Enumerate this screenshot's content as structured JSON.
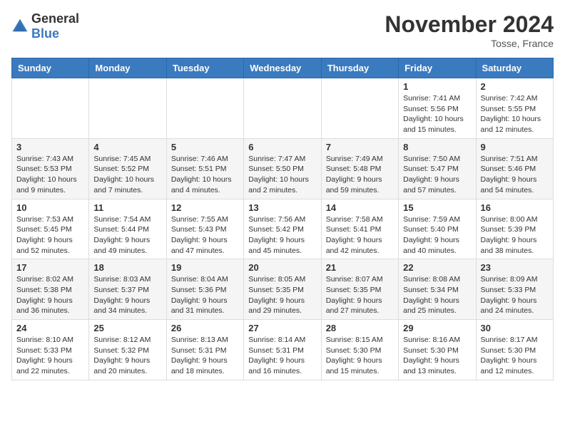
{
  "header": {
    "logo_general": "General",
    "logo_blue": "Blue",
    "title": "November 2024",
    "location": "Tosse, France"
  },
  "weekdays": [
    "Sunday",
    "Monday",
    "Tuesday",
    "Wednesday",
    "Thursday",
    "Friday",
    "Saturday"
  ],
  "weeks": [
    [
      {
        "day": "",
        "info": ""
      },
      {
        "day": "",
        "info": ""
      },
      {
        "day": "",
        "info": ""
      },
      {
        "day": "",
        "info": ""
      },
      {
        "day": "",
        "info": ""
      },
      {
        "day": "1",
        "info": "Sunrise: 7:41 AM\nSunset: 5:56 PM\nDaylight: 10 hours\nand 15 minutes."
      },
      {
        "day": "2",
        "info": "Sunrise: 7:42 AM\nSunset: 5:55 PM\nDaylight: 10 hours\nand 12 minutes."
      }
    ],
    [
      {
        "day": "3",
        "info": "Sunrise: 7:43 AM\nSunset: 5:53 PM\nDaylight: 10 hours\nand 9 minutes."
      },
      {
        "day": "4",
        "info": "Sunrise: 7:45 AM\nSunset: 5:52 PM\nDaylight: 10 hours\nand 7 minutes."
      },
      {
        "day": "5",
        "info": "Sunrise: 7:46 AM\nSunset: 5:51 PM\nDaylight: 10 hours\nand 4 minutes."
      },
      {
        "day": "6",
        "info": "Sunrise: 7:47 AM\nSunset: 5:50 PM\nDaylight: 10 hours\nand 2 minutes."
      },
      {
        "day": "7",
        "info": "Sunrise: 7:49 AM\nSunset: 5:48 PM\nDaylight: 9 hours\nand 59 minutes."
      },
      {
        "day": "8",
        "info": "Sunrise: 7:50 AM\nSunset: 5:47 PM\nDaylight: 9 hours\nand 57 minutes."
      },
      {
        "day": "9",
        "info": "Sunrise: 7:51 AM\nSunset: 5:46 PM\nDaylight: 9 hours\nand 54 minutes."
      }
    ],
    [
      {
        "day": "10",
        "info": "Sunrise: 7:53 AM\nSunset: 5:45 PM\nDaylight: 9 hours\nand 52 minutes."
      },
      {
        "day": "11",
        "info": "Sunrise: 7:54 AM\nSunset: 5:44 PM\nDaylight: 9 hours\nand 49 minutes."
      },
      {
        "day": "12",
        "info": "Sunrise: 7:55 AM\nSunset: 5:43 PM\nDaylight: 9 hours\nand 47 minutes."
      },
      {
        "day": "13",
        "info": "Sunrise: 7:56 AM\nSunset: 5:42 PM\nDaylight: 9 hours\nand 45 minutes."
      },
      {
        "day": "14",
        "info": "Sunrise: 7:58 AM\nSunset: 5:41 PM\nDaylight: 9 hours\nand 42 minutes."
      },
      {
        "day": "15",
        "info": "Sunrise: 7:59 AM\nSunset: 5:40 PM\nDaylight: 9 hours\nand 40 minutes."
      },
      {
        "day": "16",
        "info": "Sunrise: 8:00 AM\nSunset: 5:39 PM\nDaylight: 9 hours\nand 38 minutes."
      }
    ],
    [
      {
        "day": "17",
        "info": "Sunrise: 8:02 AM\nSunset: 5:38 PM\nDaylight: 9 hours\nand 36 minutes."
      },
      {
        "day": "18",
        "info": "Sunrise: 8:03 AM\nSunset: 5:37 PM\nDaylight: 9 hours\nand 34 minutes."
      },
      {
        "day": "19",
        "info": "Sunrise: 8:04 AM\nSunset: 5:36 PM\nDaylight: 9 hours\nand 31 minutes."
      },
      {
        "day": "20",
        "info": "Sunrise: 8:05 AM\nSunset: 5:35 PM\nDaylight: 9 hours\nand 29 minutes."
      },
      {
        "day": "21",
        "info": "Sunrise: 8:07 AM\nSunset: 5:35 PM\nDaylight: 9 hours\nand 27 minutes."
      },
      {
        "day": "22",
        "info": "Sunrise: 8:08 AM\nSunset: 5:34 PM\nDaylight: 9 hours\nand 25 minutes."
      },
      {
        "day": "23",
        "info": "Sunrise: 8:09 AM\nSunset: 5:33 PM\nDaylight: 9 hours\nand 24 minutes."
      }
    ],
    [
      {
        "day": "24",
        "info": "Sunrise: 8:10 AM\nSunset: 5:33 PM\nDaylight: 9 hours\nand 22 minutes."
      },
      {
        "day": "25",
        "info": "Sunrise: 8:12 AM\nSunset: 5:32 PM\nDaylight: 9 hours\nand 20 minutes."
      },
      {
        "day": "26",
        "info": "Sunrise: 8:13 AM\nSunset: 5:31 PM\nDaylight: 9 hours\nand 18 minutes."
      },
      {
        "day": "27",
        "info": "Sunrise: 8:14 AM\nSunset: 5:31 PM\nDaylight: 9 hours\nand 16 minutes."
      },
      {
        "day": "28",
        "info": "Sunrise: 8:15 AM\nSunset: 5:30 PM\nDaylight: 9 hours\nand 15 minutes."
      },
      {
        "day": "29",
        "info": "Sunrise: 8:16 AM\nSunset: 5:30 PM\nDaylight: 9 hours\nand 13 minutes."
      },
      {
        "day": "30",
        "info": "Sunrise: 8:17 AM\nSunset: 5:30 PM\nDaylight: 9 hours\nand 12 minutes."
      }
    ]
  ]
}
